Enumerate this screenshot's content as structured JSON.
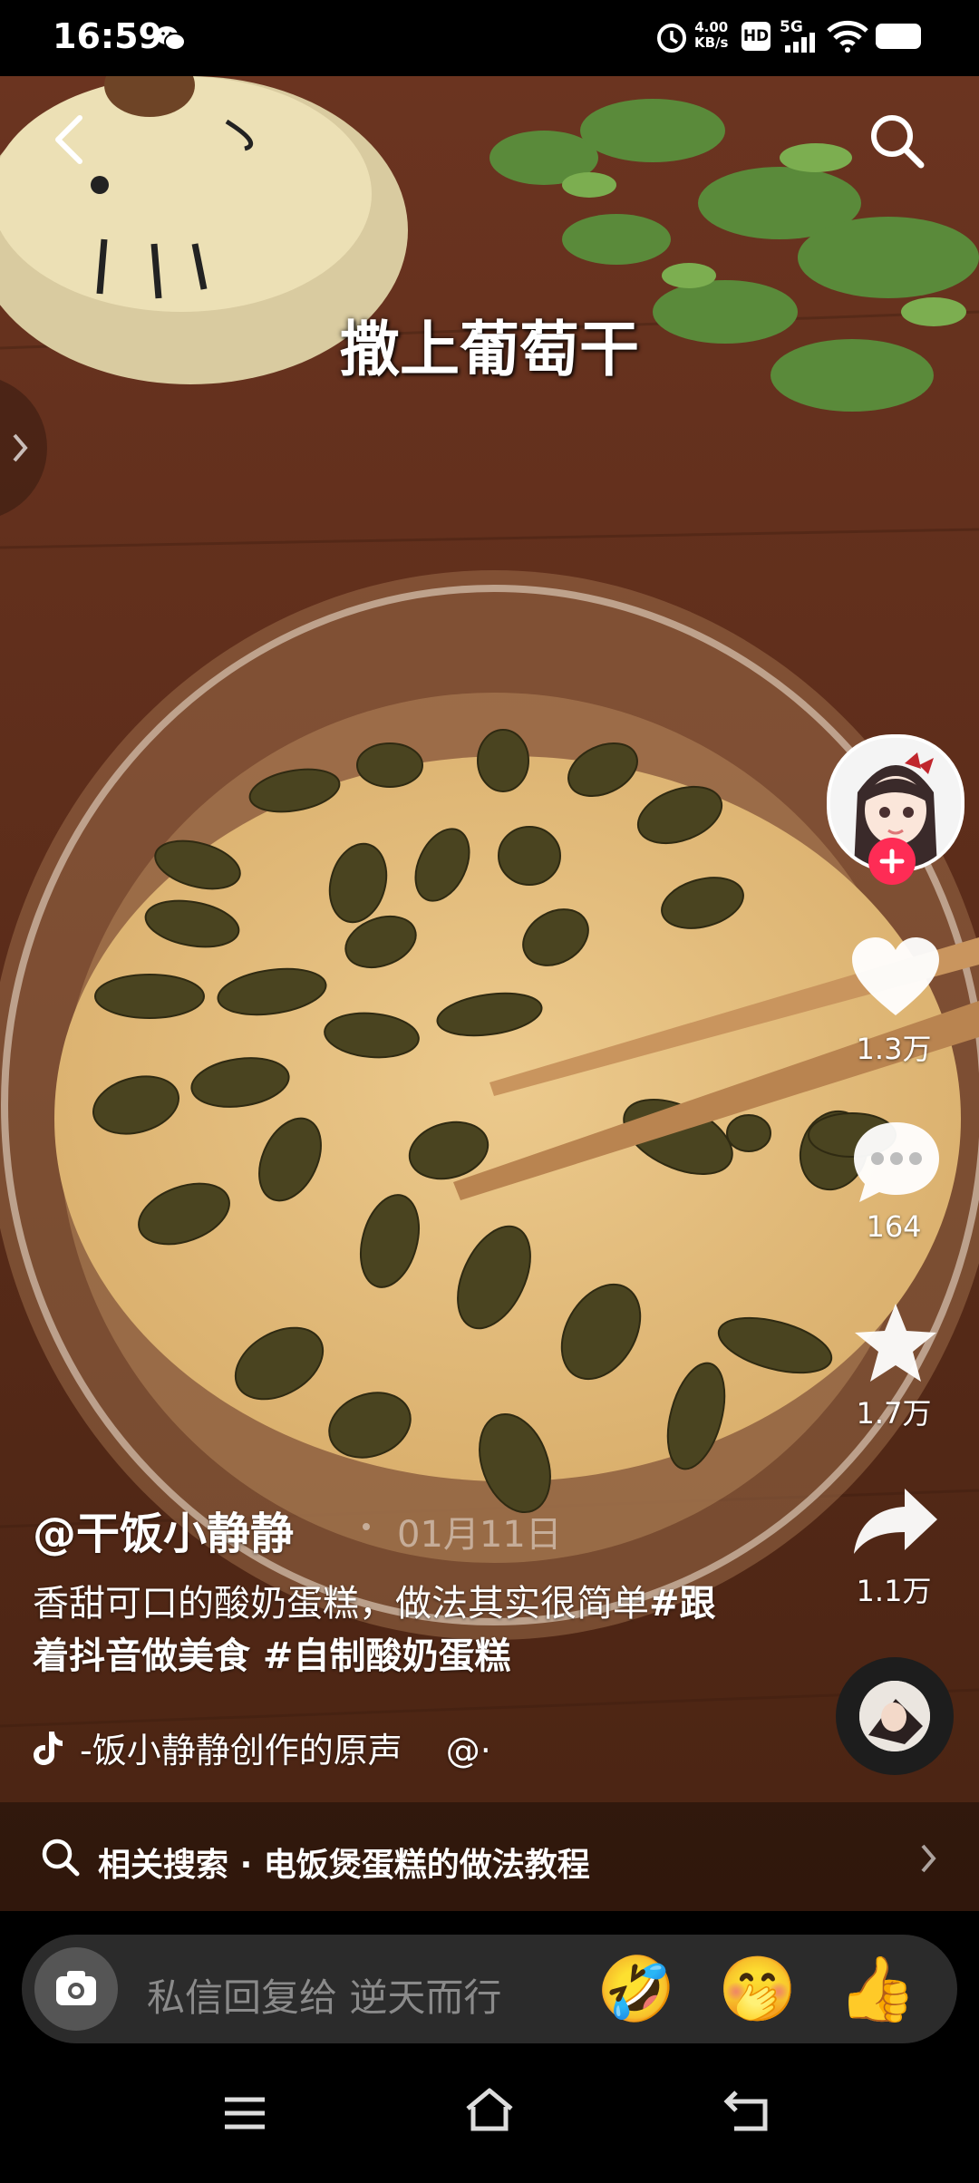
{
  "status_bar": {
    "time": "16:59",
    "net_speed_value": "4.00",
    "net_speed_unit": "KB/s",
    "hd_label": "HD",
    "network_label": "5G"
  },
  "video": {
    "overlay_caption": "撒上葡萄干"
  },
  "rail": {
    "likes": "1.3万",
    "comments": "164",
    "favorites": "1.7万",
    "shares": "1.1万"
  },
  "post": {
    "author": "@干饭小静静",
    "date": "01月11日",
    "description": "香甜可口的酸奶蛋糕，做法其实很简单",
    "hashtags": "#跟着抖音做美食 #自制酸奶蛋糕",
    "music": "-饭小静静创作的原声",
    "music_suffix": "@·"
  },
  "related_search": {
    "label": "相关搜索",
    "separator": "·",
    "query": "电饭煲蛋糕的做法教程"
  },
  "reply": {
    "placeholder": "私信回复给 逆天而行",
    "emojis": [
      "🤣",
      "🤭",
      "👍"
    ]
  },
  "colors": {
    "accent": "#fe2c55",
    "batter": "#e7c485",
    "table": "#6b3a20"
  }
}
